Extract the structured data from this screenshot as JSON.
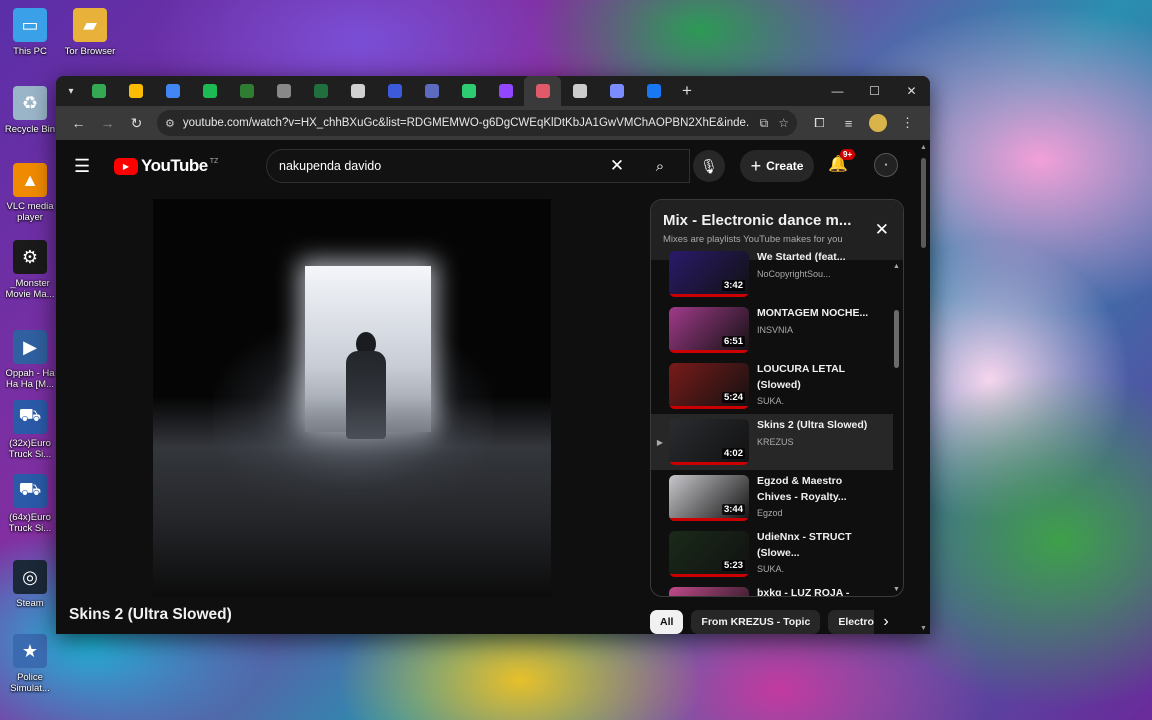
{
  "desktop": {
    "icons": [
      {
        "label": "This PC",
        "icon": "computer-icon",
        "color": "#3aa0e8"
      },
      {
        "label": "Tor Browser",
        "icon": "folder-icon",
        "color": "#e8b23a"
      },
      {
        "label": "Recycle Bin",
        "icon": "recycle-bin-icon",
        "color": "#9ab4c8"
      },
      {
        "label": "VLC media player",
        "icon": "vlc-icon",
        "color": "#f08a00"
      },
      {
        "label": "_Monster Movie Ma...",
        "icon": "gear-icon",
        "color": "#1a1a1a"
      },
      {
        "label": "Oppah - Ha Ha Ha [M...",
        "icon": "video-file-icon",
        "color": "#3060a0"
      },
      {
        "label": "(32x)Euro Truck Si...",
        "icon": "truck-icon",
        "color": "#2a5aa8"
      },
      {
        "label": "(64x)Euro Truck Si...",
        "icon": "truck-icon",
        "color": "#2a5aa8"
      },
      {
        "label": "Steam",
        "icon": "steam-icon",
        "color": "#1b2838"
      },
      {
        "label": "Police Simulat...",
        "icon": "police-icon",
        "color": "#3a6ab0"
      }
    ]
  },
  "browser": {
    "tab_colors": [
      "#34a853",
      "#fbbc04",
      "#4285f4",
      "#1db954",
      "#2e7d32",
      "#888888",
      "#1f6f3f",
      "#d0d0d0",
      "#3b5bdb",
      "#5c6bc0",
      "#2ecc71",
      "#9146ff",
      "#e05a6a",
      "#cccccc",
      "#7a8cff",
      "#1877f2"
    ],
    "active_tab_index": 12,
    "url": "youtube.com/watch?v=HX_chhBXuGc&list=RDGMEMWO-g6DgCWEqKlDtKbJA1GwVMChAOPBN2XhE&inde..."
  },
  "youtube": {
    "logo_text": "YouTube",
    "country_code": "TZ",
    "search_query": "nakupenda davido",
    "create_label": "Create",
    "notification_count": "9+",
    "video_title": "Skins 2 (Ultra Slowed)",
    "playlist": {
      "title": "Mix - Electronic dance m...",
      "subtitle": "Mixes are playlists YouTube makes for you",
      "items": [
        {
          "name": "We Started (feat...",
          "channel": "NoCopyrightSou...",
          "duration": "3:42",
          "thumb": "#2a1a6a",
          "current": false
        },
        {
          "name": "MONTAGEM NOCHE...",
          "channel": "INSVNIA",
          "duration": "6:51",
          "thumb": "#a03a8a",
          "current": false
        },
        {
          "name": "LOUCURA LETAL (Slowed)",
          "channel": "SUKA.",
          "duration": "5:24",
          "thumb": "#7a1a1a",
          "current": false
        },
        {
          "name": "Skins 2 (Ultra Slowed)",
          "channel": "KREZUS",
          "duration": "4:02",
          "thumb": "#2a2c30",
          "current": true
        },
        {
          "name": "Egzod & Maestro Chives - Royalty...",
          "channel": "Egzod",
          "duration": "3:44",
          "thumb": "#c8c8cc",
          "current": false
        },
        {
          "name": "UdieNnx - STRUCT (Slowe...",
          "channel": "SUKA.",
          "duration": "5:23",
          "thumb": "#1a2a1a",
          "current": false
        },
        {
          "name": "bxkq - LUZ ROJA - Slowed (Official",
          "channel": "",
          "duration": "",
          "thumb": "#c04a8a",
          "current": false
        }
      ]
    },
    "chips": [
      "All",
      "From KREZUS - Topic",
      "Electro"
    ]
  }
}
